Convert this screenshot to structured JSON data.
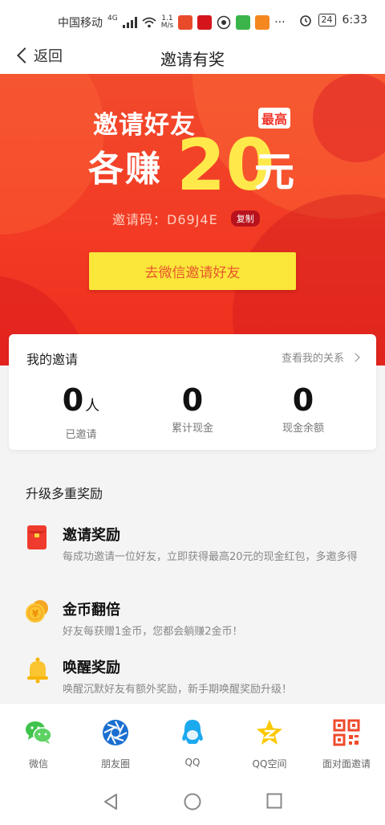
{
  "status_bar": {
    "carrier": "中国移动",
    "network": "4G",
    "speed_value": "1.1",
    "speed_unit": "M/s",
    "battery": "24",
    "time": "6:33",
    "more": "···"
  },
  "nav": {
    "back_label": "返回",
    "title": "邀请有奖"
  },
  "banner": {
    "line1": "邀请好友",
    "line2": "各赚",
    "amount": "20",
    "unit": "元",
    "badge": "最高",
    "code_text": "邀请码：D69J4E",
    "copy_label": "复制",
    "invite_button": "去微信邀请好友"
  },
  "my_invites": {
    "title": "我的邀请",
    "link_label": "查看我的关系",
    "stats": [
      {
        "value": "0",
        "unit": "人",
        "label": "已邀请"
      },
      {
        "value": "0",
        "unit": "",
        "label": "累计现金"
      },
      {
        "value": "0",
        "unit": "",
        "label": "现金余额"
      }
    ]
  },
  "rewards": {
    "title": "升级多重奖励",
    "items": [
      {
        "title": "邀请奖励",
        "desc": "每成功邀请一位好友，立即获得最高20元的现金红包，多邀多得",
        "icon": "red-envelope-icon"
      },
      {
        "title": "金币翻倍",
        "desc": "好友每获赠1金币，您都会躺赚2金币！",
        "icon": "gold-coin-icon"
      },
      {
        "title": "唤醒奖励",
        "desc": "唤醒沉默好友有额外奖励，新手期唤醒奖励升级！",
        "icon": "bell-icon"
      }
    ]
  },
  "share": {
    "items": [
      {
        "label": "微信",
        "icon": "wechat-icon"
      },
      {
        "label": "朋友圈",
        "icon": "moments-icon"
      },
      {
        "label": "QQ",
        "icon": "qq-icon"
      },
      {
        "label": "QQ空间",
        "icon": "qzone-icon"
      },
      {
        "label": "面对面邀请",
        "icon": "qr-code-icon"
      }
    ]
  },
  "colors": {
    "banner_red": "#f23a24",
    "button_yellow": "#fbe63a",
    "button_text": "#e8572c",
    "amount_yellow": "#ffe94a"
  }
}
